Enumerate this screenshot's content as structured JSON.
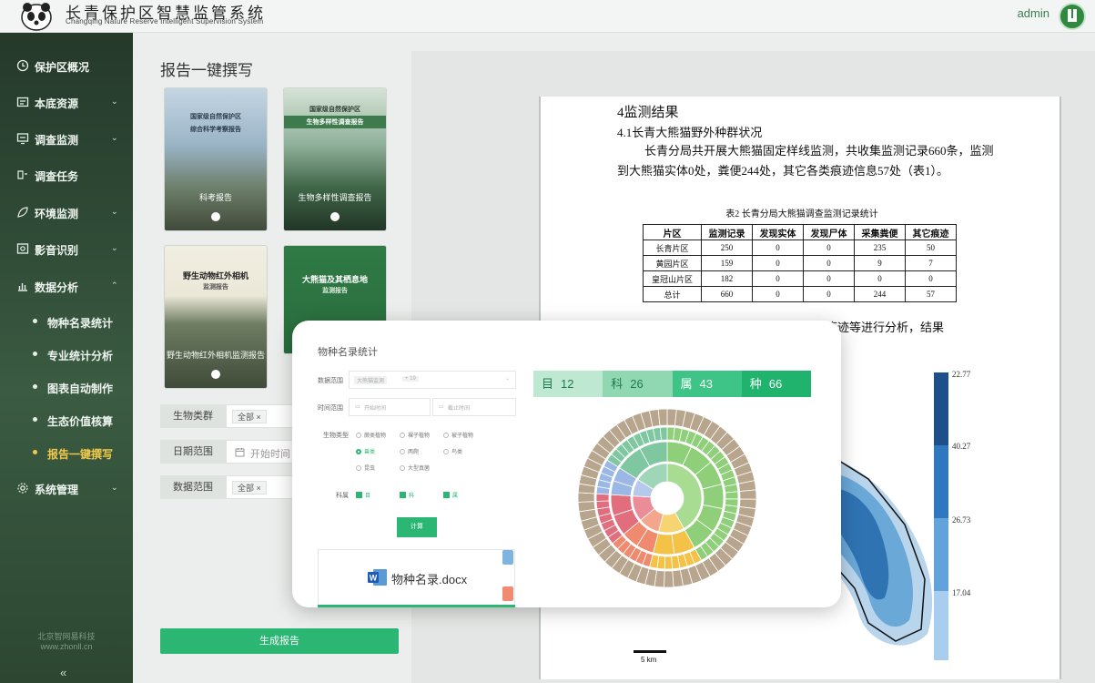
{
  "header": {
    "title": "长青保护区智慧监管系统",
    "subtitle": "Changqing Nature Reserve Intelligent Supervision System",
    "username": "admin"
  },
  "sidebar": {
    "items": [
      {
        "label": "保护区概况",
        "icon": "clock-icon",
        "expandable": false
      },
      {
        "label": "本底资源",
        "icon": "resource-icon",
        "expandable": true
      },
      {
        "label": "调查监测",
        "icon": "monitor-icon",
        "expandable": true
      },
      {
        "label": "调查任务",
        "icon": "task-icon",
        "expandable": false
      },
      {
        "label": "环境监测",
        "icon": "leaf-icon",
        "expandable": true
      },
      {
        "label": "影音识别",
        "icon": "camera-icon",
        "expandable": true
      },
      {
        "label": "数据分析",
        "icon": "bar-chart-icon",
        "expandable": true
      },
      {
        "label": "系统管理",
        "icon": "gear-icon",
        "expandable": true
      }
    ],
    "sub_items": [
      {
        "label": "物种名录统计"
      },
      {
        "label": "专业统计分析"
      },
      {
        "label": "图表自动制作"
      },
      {
        "label": "生态价值核算"
      },
      {
        "label": "报告一键撰写",
        "active": true
      }
    ],
    "footer_line1": "北京智网易科技",
    "footer_line2": "www.zhonll.cn",
    "collapse": "«"
  },
  "main": {
    "title": "报告一键撰写",
    "reports": [
      {
        "label": "科考报告",
        "head1": "国家级自然保护区",
        "head2": "综合科学考察报告"
      },
      {
        "label": "生物多样性调查报告",
        "head1": "国家级自然保护区",
        "head2": "生物多样性调查报告"
      },
      {
        "label": "野生动物红外相机监测报告",
        "head1": "野生动物红外相机",
        "head2": "监测报告"
      },
      {
        "label": "大熊猫及其栖息地监测报告",
        "head1": "大熊猫及其栖息地",
        "head2": "监测报告"
      }
    ],
    "form": {
      "species_label": "生物类群",
      "species_tag": "全部",
      "date_label": "日期范围",
      "date_placeholder": "开始时间",
      "data_label": "数据范围",
      "data_tag": "全部"
    },
    "generate_button": "生成报告"
  },
  "document": {
    "heading1": "4监测结果",
    "heading2": "4.1长青大熊猫野外种群状况",
    "paragraph": "长青分局共开展大熊猫固定样线监测，共收集监测记录660条，监测到大熊猫实体0处，粪便244处，其它各类痕迹信息57处（表1）。",
    "table_caption": "表2 长青分局大熊猫调查监测记录统计",
    "table_headers": [
      "片区",
      "监测记录",
      "发现实体",
      "发现尸体",
      "采集粪便",
      "其它痕迹"
    ],
    "table_rows": [
      [
        "长青片区",
        "250",
        "0",
        "0",
        "235",
        "50"
      ],
      [
        "黄园片区",
        "159",
        "0",
        "0",
        "9",
        "7"
      ],
      [
        "皇冠山片区",
        "182",
        "0",
        "0",
        "0",
        "0"
      ],
      [
        "总计",
        "660",
        "0",
        "0",
        "244",
        "57"
      ]
    ],
    "paragraph2": "根据GIS核密度分析对大熊猫实体和痕迹等进行分析，结果",
    "colorbar_labels": [
      "22.77",
      "40.27",
      "26.73",
      "17.04"
    ],
    "scale_label": "5 km"
  },
  "popup": {
    "title": "物种名录统计",
    "data_range_label": "数据范围",
    "data_range_tag": "大熊猫监测",
    "data_range_more": "+ 19",
    "time_range_label": "时间范围",
    "start_placeholder": "开始时间",
    "end_placeholder": "截止时间",
    "bio_type_label": "生物类型",
    "bio_types": [
      "蕨类植物",
      "裸子植物",
      "被子植物",
      "兽类",
      "两爬",
      "鸟类",
      "昆虫",
      "大型真菌"
    ],
    "bio_type_selected": "兽类",
    "rank_label": "科属",
    "ranks": [
      "目",
      "科",
      "属"
    ],
    "calc_button": "计算",
    "file_name": "物种名录.docx",
    "stats": [
      {
        "label": "目",
        "value": "12",
        "color": "#bfe8d3"
      },
      {
        "label": "科",
        "value": "26",
        "color": "#8fd8b2"
      },
      {
        "label": "属",
        "value": "43",
        "color": "#3fc487"
      },
      {
        "label": "种",
        "value": "66",
        "color": "#1fb36e"
      }
    ]
  }
}
